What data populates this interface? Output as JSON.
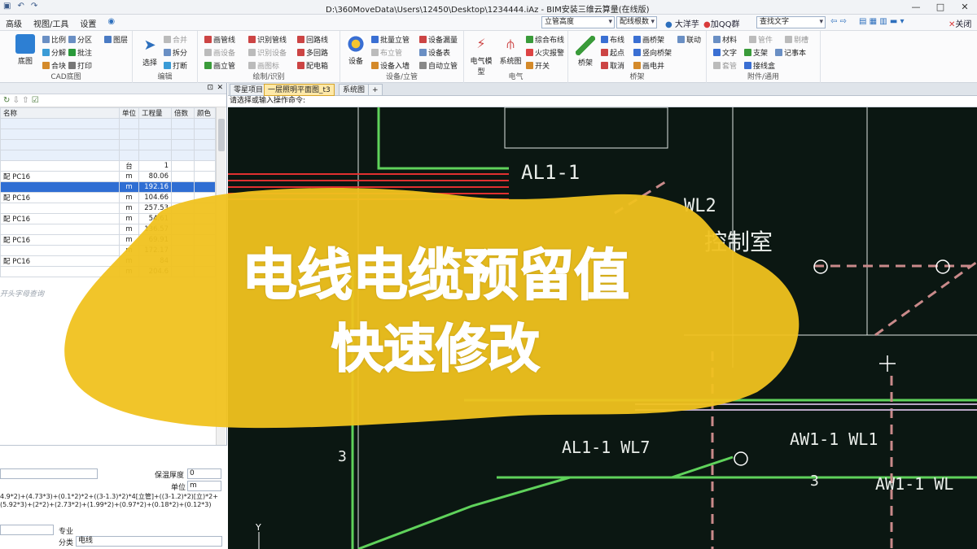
{
  "titlebar": {
    "title": "D:\\360MoveData\\Users\\12450\\Desktop\\1234444.iAz - BIM安装三维云算量(在线版)",
    "min": "—",
    "max": "□",
    "close": "✕"
  },
  "menubar": {
    "items": [
      "高级",
      "视图/工具",
      "设置"
    ],
    "combo1": "立管高度",
    "combo2": "配线根数",
    "user": "大洋芋",
    "qq": "加QQ群",
    "search_placeholder": "查找文字",
    "close_label": "关闭"
  },
  "ribbon": {
    "groups": [
      {
        "label": "CAD底图",
        "big": "底图",
        "items": [
          "比例",
          "分区",
          "图层",
          "分解",
          "批注",
          "合块",
          "打印"
        ]
      },
      {
        "label": "编辑",
        "big": "选择",
        "items": [
          "合并",
          "拆分",
          "打断"
        ]
      },
      {
        "label": "绘制/识别",
        "items": [
          "画管线",
          "识别管线",
          "回路线",
          "画设备",
          "识别设备",
          "多回路",
          "画立管",
          "画图标",
          "配电箱"
        ]
      },
      {
        "label": "设备/立管",
        "big": "设备",
        "items": [
          "批量立管",
          "设备漏量",
          "布立管",
          "设备表",
          "设备入墙",
          "自动立管"
        ]
      },
      {
        "label": "电气",
        "big": "电气模型",
        "big2": "系统图",
        "items": [
          "综合布线",
          "火灾报警",
          "开关"
        ]
      },
      {
        "label": "桥架",
        "big": "桥架",
        "items": [
          "布线",
          "画桥架",
          "联动",
          "起点",
          "竖向桥架",
          "取消",
          "画电井"
        ]
      },
      {
        "label": "附件/通用",
        "items": [
          "材料",
          "管件",
          "剔槽",
          "文字",
          "支架",
          "记事本",
          "套管",
          "接线盒"
        ]
      }
    ]
  },
  "left_panel": {
    "columns": [
      "名称",
      "单位",
      "工程量",
      "倍数",
      "颜色"
    ],
    "rows": [
      {
        "name": "",
        "unit": "",
        "qty": ""
      },
      {
        "name": "",
        "unit": "",
        "qty": ""
      },
      {
        "name": "",
        "unit": "",
        "qty": ""
      },
      {
        "name": "",
        "unit": "",
        "qty": ""
      },
      {
        "name": "",
        "unit": "台",
        "qty": "1"
      },
      {
        "name": "配 PC16",
        "unit": "m",
        "qty": "80.06"
      },
      {
        "name": "",
        "unit": "m",
        "qty": "192.16",
        "selected": true
      },
      {
        "name": "配 PC16",
        "unit": "m",
        "qty": "104.66"
      },
      {
        "name": "",
        "unit": "m",
        "qty": "257.53"
      },
      {
        "name": "配 PC16",
        "unit": "m",
        "qty": "54.61"
      },
      {
        "name": "",
        "unit": "m",
        "qty": "136.57"
      },
      {
        "name": "配 PC16",
        "unit": "m",
        "qty": "69.91"
      },
      {
        "name": "",
        "unit": "m",
        "qty": "172.17"
      },
      {
        "name": "配 PC16",
        "unit": "m",
        "qty": "84"
      },
      {
        "name": "",
        "unit": "m",
        "qty": "204.6"
      }
    ],
    "search_hint": "开头字母查询",
    "props": {
      "insulation_label": "保温厚度",
      "insulation_value": "0",
      "unit_label": "单位",
      "unit_value": "m",
      "formula": "4.9*2)+(4.73*3)+(0.1*2)*2+((3-1.3)*2)*4[立管]+((3-1.2)*2)[立)*2+(5.92*3)+(2*2)+(2.73*2)+(1.99*2)+(0.97*2)+(0.18*2)+(0.12*3)",
      "major_label": "专业",
      "class_label": "分类",
      "class_value": "电线"
    }
  },
  "cad": {
    "tabs": [
      "零星项目",
      "一层照明平面图_t3",
      "系统图"
    ],
    "command_prompt": "请选择或输入操作命令:",
    "labels": [
      "AL1-1",
      "WL2",
      "控制室",
      "AL1-1 WL7",
      "AW1-1 WL1",
      "AW1-1 WL",
      "3",
      "3"
    ]
  },
  "overlay": {
    "line1": "电线电缆预留值",
    "line2": "快速修改",
    "blob_color": "#f0c21f"
  },
  "colors": {
    "cad_bg": "#0b1712",
    "wire_green": "#5fd25b",
    "wire_red": "#e03030",
    "dash_pink": "#c98a8a",
    "selection_blue": "#2f6ed3"
  }
}
